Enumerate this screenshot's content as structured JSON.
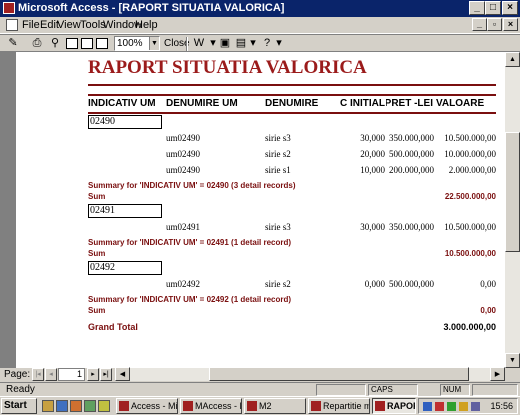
{
  "window": {
    "title": "Microsoft Access - [RAPORT SITUATIA VALORICA]",
    "min": "_",
    "max": "□",
    "close": "×"
  },
  "menu": {
    "items": [
      "File",
      "Edit",
      "View",
      "Tools",
      "Window",
      "Help"
    ],
    "mdi_min": "_",
    "mdi_restore": "▫",
    "mdi_close": "×"
  },
  "toolbar": {
    "zoom": "100%",
    "close_label": "Close"
  },
  "report": {
    "title": "RAPORT SITUATIA VALORICA",
    "headers": [
      "INDICATIV UM",
      "DENUMIRE UM",
      "DENUMIRE",
      "OC INITIAL",
      "PRET -LEI",
      "VALOARE"
    ],
    "groups": [
      {
        "id": "02490",
        "rows": [
          [
            "um02490",
            "sirie  s3",
            "30,000",
            "350.000,000",
            "10.500.000,00"
          ],
          [
            "um02490",
            "sirie  s2",
            "20,000",
            "500.000,000",
            "10.000.000,00"
          ],
          [
            "um02490",
            "sirie  s1",
            "10,000",
            "200.000,000",
            "2.000.000,00"
          ]
        ],
        "summary": "Summary for 'INDICATIV UM' =  02490 (3 detail records)",
        "sum_label": "Sum",
        "sum_value": "22.500.000,00"
      },
      {
        "id": "02491",
        "rows": [
          [
            "um02491",
            "sirie  s3",
            "30,000",
            "350.000,000",
            "10.500.000,00"
          ]
        ],
        "summary": "Summary for 'INDICATIV UM' =  02491 (1 detail record)",
        "sum_label": "Sum",
        "sum_value": "10.500.000,00"
      },
      {
        "id": "02492",
        "rows": [
          [
            "um02492",
            "sirie  s2",
            "0,000",
            "500.000,000",
            "0,00"
          ]
        ],
        "summary": "Summary for 'INDICATIV UM' =  02492 (1 detail record)",
        "sum_label": "Sum",
        "sum_value": "0,00"
      }
    ],
    "grand_total_label": "Grand Total",
    "grand_total_value": "3.000.000,00"
  },
  "nav": {
    "label": "Page:",
    "page": "1",
    "first": "|◂",
    "prev": "◂",
    "next": "▸",
    "last": "▸|"
  },
  "status": {
    "text": "Ready",
    "caps": "CAPS",
    "num": "NUM"
  },
  "taskbar": {
    "start": "Start",
    "buttons": [
      "Access - Mic...",
      "MAccess - M...",
      "M2",
      "Repartitie ma...",
      "RAPORT ..."
    ],
    "clock": "15:56"
  },
  "colors": {
    "title_bar": "#0a246a",
    "report_accent": "#9b1b1b"
  }
}
